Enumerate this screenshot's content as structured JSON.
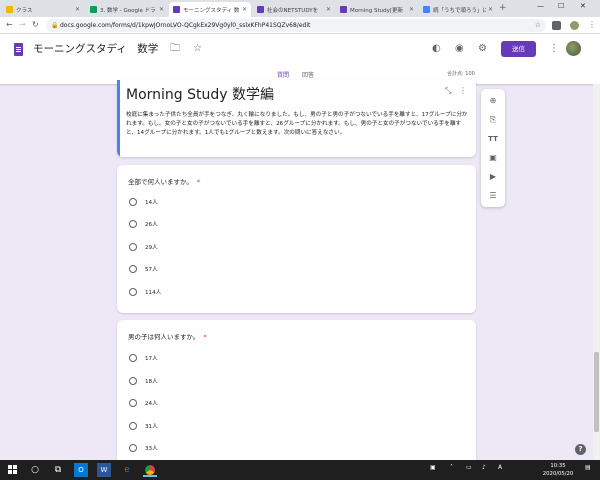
{
  "browser": {
    "tabs": [
      {
        "label": "クラス",
        "color": "#f4b400",
        "active": false
      },
      {
        "label": "3. 数学 - Google ドラ",
        "color": "#0f9d58",
        "active": false
      },
      {
        "label": "モーニングスタディ 数",
        "color": "#673ab7",
        "active": true
      },
      {
        "label": "社会のNETSTUDYを",
        "color": "#673ab7",
        "active": false
      },
      {
        "label": "Morning Study[更新",
        "color": "#673ab7",
        "active": false
      },
      {
        "label": "続「うちで頑ろう」にチ",
        "color": "#4285f4",
        "active": false
      }
    ],
    "new_tab": "+",
    "url": "docs.google.com/forms/d/1kpwJOrnoLVO-QCgkEx29Vg0yl0_sslxKFhP41SQZv68/edit"
  },
  "form_header": {
    "title": "モーニングスタディ　数学",
    "send_label": "送信",
    "tabs": [
      "質問",
      "回答"
    ],
    "total_score": "合計点: 100"
  },
  "form": {
    "title": "Morning Study 数学編",
    "description": "校庭に集まった子供たち全員が手をつなぎ、丸く輪になりました。もし、男の子と男の子がつないでいる手を離すと、17グループに分かれます。もし、女の子と女の子がつないでいる手を離すと、26グループに分かれます。もし、男の子と女の子がつないでいる手を離すと、14グループに分かれます。1人でも1グループと数えます。次の問いに答えなさい。"
  },
  "questions": [
    {
      "text": "全部で何人いますか。",
      "required_mark": "*",
      "options": [
        "14人",
        "26人",
        "29人",
        "57人",
        "114人"
      ]
    },
    {
      "text": "男の子は何人いますか。",
      "required_mark": "*",
      "options": [
        "17人",
        "18人",
        "24人",
        "31人",
        "33人"
      ]
    }
  ],
  "taskbar": {
    "time": "10:35",
    "date": "2020/05/20"
  },
  "colors": {
    "accent": "#673ab7",
    "background": "#ede7f6",
    "required": "#d93025"
  }
}
